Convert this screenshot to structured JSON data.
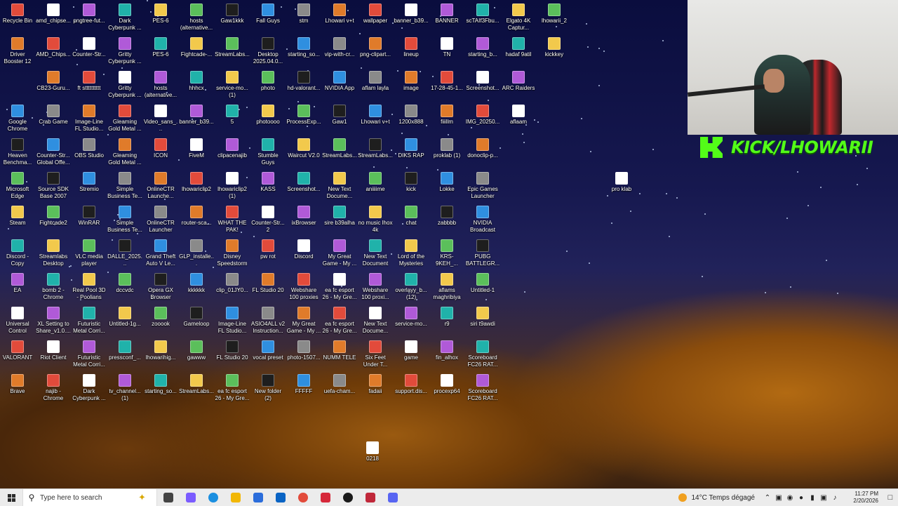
{
  "desktop": {
    "columns": [
      [
        "Recycle Bin",
        "Driver Booster 12",
        "",
        "Google Chrome",
        "Heaven Benchma...",
        "Microsoft Edge",
        "Steam",
        "Discord - Copy",
        "EA",
        "Universal Control",
        "VALORANT",
        "Brave"
      ],
      [
        "amd_chipse...",
        "AMD_Chips...",
        "CB23-Guru...",
        "Crab Game",
        "Counter-Str... Global Offe...",
        "Source SDK Base 2007",
        "Fightcade2",
        "Streamlabs Desktop",
        "bomb 2 - Chrome",
        "XL Setting to Share_v1.0....",
        "Riot Client",
        "najib - Chrome"
      ],
      [
        "pngtree-fut...",
        "Counter-Str...",
        "ft stttttttttt",
        "Image-Line FL Studio...",
        "OBS Studio",
        "Stremio",
        "WinRAR",
        "VLC media player",
        "Real Pool 3D - Poolians",
        "Futuristic Metal Corri...",
        "Futuristic Metal Corri...",
        "Dark Cyberpunk ..."
      ],
      [
        "Dark Cyberpunk ...",
        "Gritty Cyberpunk ...",
        "Gritty Cyberpunk ...",
        "Gleaming Gold Metal ...",
        "Gleaming Gold Metal ...",
        "Simple Business Te...",
        "Simple Business Te...",
        "DALLE_2025...",
        "dccvdc",
        "Untitled-1g...",
        "pressconf_...",
        "tv_channel... (1)"
      ],
      [
        "PES-6",
        "PES-6",
        "hosts (alternative...",
        "Video_sans_...",
        "ICON",
        "OnlineCTR Launche...",
        "OnlineCTR Launcher",
        "Grand Theft Auto V Le...",
        "Opera GX Browser",
        "zooook",
        "lhowarihig...",
        "starting_so..."
      ],
      [
        "hosts (alternative...",
        "Fightcade-...",
        "hhhcx",
        "banner_b39...",
        "FiveM",
        "lhowariclip2",
        "router-sca...",
        "GLP_installe...",
        "kkkkkk",
        "Gameloop",
        "gawww",
        "StreamLabs..."
      ],
      [
        "Gaw1kkk",
        "StreamLabs...",
        "service-mo... (1)",
        "5",
        "clipacenajib",
        "lhowariclip2 (1)",
        "WHAT THE PAK!",
        "Disney Speedstorm",
        "clip_01JY0...",
        "Image-Line FL Studio...",
        "FL Studio 20",
        "ea fc esport 26 - My Gre..."
      ],
      [
        "Fall Guys",
        "Desktop 2025.04.0...",
        "photo",
        "photoooo",
        "Stumble Guys",
        "KASS",
        "Counter-Str... 2",
        "pw rot",
        "FL Studio 20",
        "ASIO4ALL v2 Instruction...",
        "vocal preset",
        "New folder (2)"
      ],
      [
        "stm",
        "starting_so...",
        "hd-valorant...",
        "ProcessExp...",
        "Waircut V2.0",
        "Screenshot...",
        "ixBrowser",
        "Discord",
        "Webshare 100 proxies",
        "My Great Game - My ...",
        "photo-1507...",
        "FFFFF"
      ],
      [
        "Lhowari v+t",
        "vip-with-cr...",
        "NVIDIA App",
        "Gaw1",
        "StreamLabs...",
        "New Text Docume...",
        "sire b39alha",
        "My Great Game - My ...",
        "ea fc esport 26 - My Gre...",
        "ea fc esport 26 - My Gre...",
        "NUMM TELE",
        "uefa-cham..."
      ],
      [
        "wallpaper",
        "png-clipart...",
        "aflam layla",
        "Lhowari v+t",
        "StreamLabs...",
        "aniiiime",
        "no music lhox 4k",
        "New Text Document",
        "Webshare 100 proxi...",
        "New Text Docume...",
        "Six Feet Under T...",
        "fadaii"
      ],
      [
        "banner_b39...",
        "lineup",
        "image",
        "1200x888",
        "DIKS RAP",
        "kick",
        "chat",
        "Lord of the Mysteries",
        "overlayy_b... (12)",
        "service-mo...",
        "game",
        "support.dis..."
      ],
      [
        "BANNER",
        "TN",
        "17-28-45-1...",
        "fiiillm",
        "proklab (1)",
        "Lokke",
        "zabbbb",
        "KRS-9KEH_...",
        "aflams maghribiya",
        "r9",
        "fin_alhox",
        "procexp64"
      ],
      [
        "scTAIf3Fbu...",
        "starting_b...",
        "Screenshot...",
        "IMG_20250...",
        "donoclip-p...",
        "Epic Games Launcher",
        "NVIDIA Broadcast",
        "PUBG BATTLEGR...",
        "Untitled-1",
        "siri t9awdi",
        "Scoreboard FC26 RAT...",
        "Scoreboard FC26 RAT..."
      ],
      [
        "Elgato 4K Captur...",
        "hadaf 9atil",
        "ARC Raiders",
        "aflaam",
        "",
        "",
        "",
        "",
        "",
        "",
        "",
        ""
      ],
      [
        "lhowarii_2",
        "kickkey",
        "",
        "",
        "",
        "",
        "",
        "",
        "",
        "",
        "",
        ""
      ]
    ],
    "extra_icons": {
      "pro_klab": "pro klab",
      "file_0218": "0218"
    }
  },
  "overlay": {
    "channel": "KICK/LHOWARII",
    "brand_color": "#53fc18"
  },
  "taskbar": {
    "search_placeholder": "Type here to search",
    "apps": [
      "task-view",
      "copilot",
      "edge",
      "file-explorer",
      "store",
      "outlook",
      "chrome",
      "valorant",
      "elgato",
      "streamlabs",
      "discord"
    ],
    "weather": "14°C  Temps dégagé",
    "time": "11:27 PM",
    "date": "2/20/2026"
  }
}
